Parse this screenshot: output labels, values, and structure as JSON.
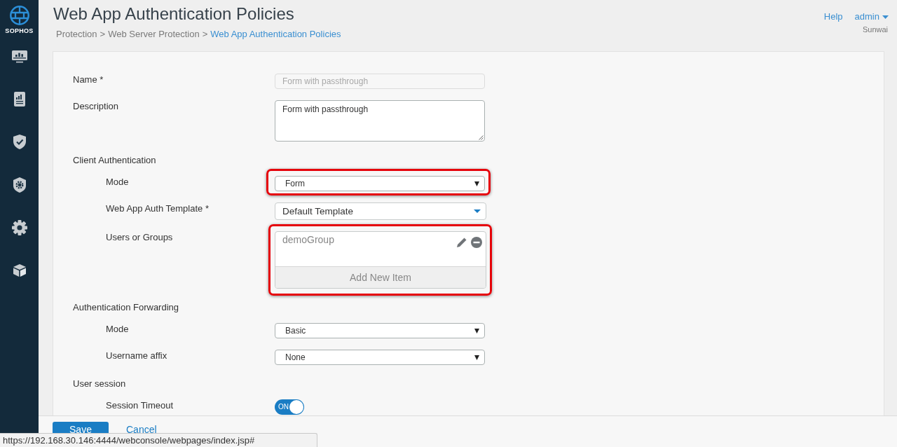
{
  "sidebar": {
    "logo_text": "SOPHOS"
  },
  "header": {
    "title": "Web App Authentication Policies",
    "breadcrumb": {
      "items": [
        {
          "label": "Protection",
          "current": false
        },
        {
          "label": "Web Server Protection",
          "current": false
        },
        {
          "label": "Web App Authentication Policies",
          "current": true
        }
      ],
      "separators": [
        ">",
        ">"
      ]
    },
    "user_menu": {
      "help": "Help",
      "user": "admin",
      "account": "Sunwai"
    }
  },
  "form": {
    "fields": [
      {
        "kind": "text",
        "label": "Name *",
        "value": "Form with passthrough",
        "disabled": true,
        "highlighted": false
      },
      {
        "kind": "textarea",
        "label": "Description",
        "value": "Form with passthrough",
        "disabled": false,
        "highlighted": false
      },
      {
        "kind": "section",
        "label": "Client Authentication",
        "children": [
          {
            "kind": "select",
            "label": "Mode",
            "value": "Form",
            "disabled": false,
            "highlighted": true
          },
          {
            "kind": "combobox",
            "label": "Web App Auth Template *",
            "value": "Default Template",
            "disabled": false,
            "highlighted": false
          },
          {
            "kind": "list",
            "label": "Users or Groups",
            "items": [
              {
                "label": "demoGroup"
              }
            ],
            "add_label": "Add New Item",
            "disabled": false,
            "highlighted": true
          }
        ]
      },
      {
        "kind": "section",
        "label": "Authentication Forwarding",
        "children": [
          {
            "kind": "select",
            "label": "Mode",
            "value": "Basic",
            "disabled": false,
            "highlighted": false
          },
          {
            "kind": "select",
            "label": "Username affix",
            "value": "None",
            "disabled": false,
            "highlighted": false
          }
        ]
      },
      {
        "kind": "section",
        "label": "User session",
        "children": [
          {
            "kind": "toggle",
            "label": "Session Timeout",
            "text": "ON",
            "on": true,
            "disabled": false,
            "highlighted": false
          }
        ]
      }
    ]
  },
  "footer": {
    "actions": [
      {
        "kind": "primary",
        "label": "Save"
      },
      {
        "kind": "link",
        "label": "Cancel"
      }
    ]
  },
  "status_bar": {
    "url": "https://192.168.30.146:4444/webconsole/webpages/index.jsp#"
  }
}
